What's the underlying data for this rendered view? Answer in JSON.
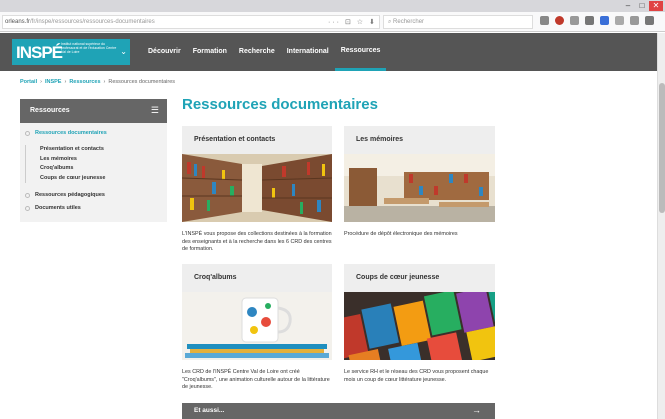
{
  "browser": {
    "url_host": "orleans.fr",
    "url_path": "/fr/inspe/ressources/ressources-documentaires",
    "url_icons": "··· ⊡ ☆ ⬇",
    "search_placeholder": "Rechercher",
    "window_controls": [
      "–",
      "□",
      "✕"
    ]
  },
  "site": {
    "logo_text": "INSPÉ",
    "logo_subtext": "Institut national supérieur du professorat et de l'éducation Centre Val de Loire",
    "nav": [
      "Découvrir",
      "Formation",
      "Recherche",
      "International",
      "Ressources"
    ],
    "active_nav": "Ressources"
  },
  "breadcrumb": [
    "Portail",
    "INSPE",
    "Ressources",
    "Ressources documentaires"
  ],
  "sidebar": {
    "title": "Ressources",
    "items": [
      {
        "label": "Ressources documentaires",
        "active": true
      },
      {
        "label": "Ressources pédagogiques",
        "active": false
      },
      {
        "label": "Documents utiles",
        "active": false
      }
    ],
    "subitems": [
      "Présentation et contacts",
      "Les mémoires",
      "Croq'albums",
      "Coups de cœur jeunesse"
    ]
  },
  "page_title": "Ressources documentaires",
  "cards": [
    {
      "title": "Présentation et contacts",
      "description": "L'INSPÉ vous propose des collections destinées à la formation des enseignants et à la recherche dans les 6 CRD des centres de formation.",
      "image": "library-shelves"
    },
    {
      "title": "Les mémoires",
      "description": "Procédure de dépôt électronique des mémoires",
      "image": "library-room"
    },
    {
      "title": "Croq'albums",
      "description": "Les CRD de l'INSPÉ Centre Val de Loire ont créé \"Croq'albums\", une animation culturelle autour de la littérature de jeunesse.",
      "image": "mug-on-books"
    },
    {
      "title": "Coups de cœur jeunesse",
      "description": "Le service RH et le réseau des CRD vous proposent chaque mois un coup de cœur littérature jeunesse.",
      "image": "book-covers"
    }
  ],
  "see_also": {
    "label": "Et aussi...",
    "arrow": "→"
  },
  "colors": {
    "accent": "#1fa3b6",
    "header": "#555555"
  }
}
